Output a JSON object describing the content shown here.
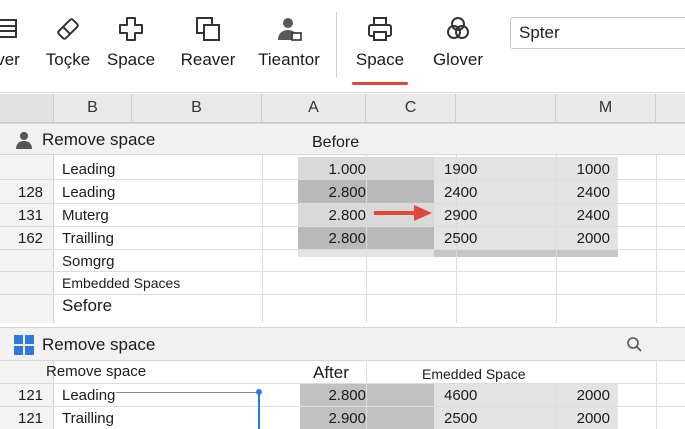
{
  "ribbon": {
    "buttons": [
      {
        "label": "ver",
        "icon": "table-icon"
      },
      {
        "label": "Toçke",
        "icon": "eraser-icon"
      },
      {
        "label": "Space",
        "icon": "plus-shape-icon"
      },
      {
        "label": "Reaver",
        "icon": "copy-window-icon"
      },
      {
        "label": "Tieantor",
        "icon": "user-icon"
      },
      {
        "label": "Space",
        "icon": "printer-icon"
      },
      {
        "label": "Glover",
        "icon": "circles-icon"
      }
    ],
    "search_value": "Spter"
  },
  "colors": {
    "accent": "#e0493a",
    "shade_dark": "#b8b8b8",
    "shade_light": "#d9d9d9",
    "win_blue": "#2f7ad6"
  },
  "columns": [
    "B",
    "B",
    "A",
    "C",
    "M"
  ],
  "section1": {
    "title": "Remove space",
    "before_label": "Before",
    "rows": [
      {
        "num": "",
        "label": "Leading",
        "a": "1.000",
        "c": "1900",
        "m": "1000"
      },
      {
        "num": "128",
        "label": "Leading",
        "a": "2.800",
        "c": "2400",
        "m": "2400"
      },
      {
        "num": "131",
        "label": "Muterg",
        "a": "2.800",
        "c": "2900",
        "m": "2400"
      },
      {
        "num": "162",
        "label": "Trailling",
        "a": "2.800",
        "c": "2500",
        "m": "2000"
      }
    ],
    "extra1": "Somgrg",
    "extra2": "Embedded Spaces",
    "extra3": "Sefore"
  },
  "section2": {
    "title": "Remove space",
    "subtitle": "Remove space",
    "after_label": "After",
    "embedded_label": "Emedded Space",
    "rows": [
      {
        "num": "121",
        "label": "Leading",
        "a": "2.800",
        "c": "4600",
        "m": "2000"
      },
      {
        "num": "121",
        "label": "Trailling",
        "a": "2.900",
        "c": "2500",
        "m": "2000"
      }
    ]
  }
}
